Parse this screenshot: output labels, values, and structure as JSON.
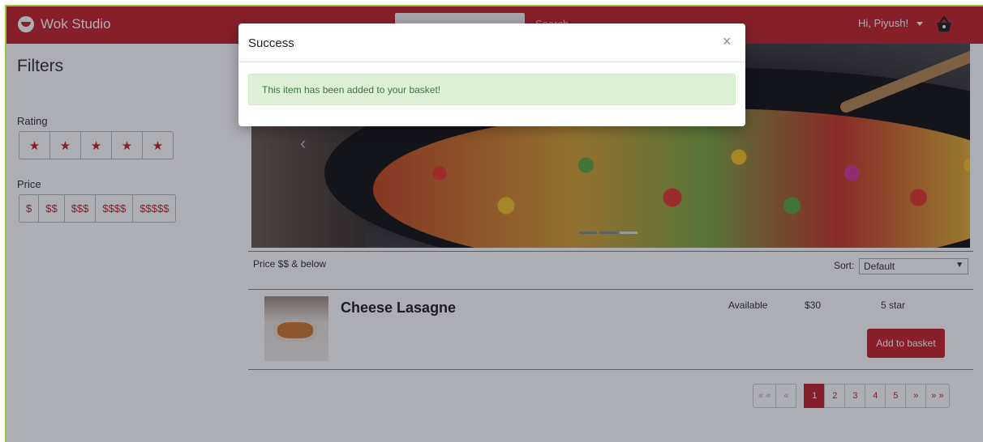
{
  "navbar": {
    "brand": "Wok Studio",
    "search_button": "Search",
    "user_greeting": "Hi, Piyush!",
    "accent_color": "#c4262b"
  },
  "sidebar": {
    "title": "Filters",
    "rating_label": "Rating",
    "rating_options": [
      "★",
      "★",
      "★",
      "★",
      "★"
    ],
    "price_label": "Price",
    "price_options": [
      "$",
      "$$",
      "$$$",
      "$$$$",
      "$$$$$"
    ]
  },
  "carousel": {
    "prev_glyph": "‹",
    "slide_count": 3,
    "active_slide": 3
  },
  "results": {
    "filter_note": "Price $$ & below",
    "sort_label": "Sort:",
    "sort_value": "Default"
  },
  "item": {
    "name": "Cheese Lasagne",
    "availability": "Available",
    "price": "$30",
    "rating": "5 star",
    "add_button": "Add to basket"
  },
  "pagination": {
    "first": "« «",
    "prev": "«",
    "pages": [
      "1",
      "2",
      "3",
      "4",
      "5"
    ],
    "active_page": "1",
    "next": "»",
    "last": "» »"
  },
  "modal": {
    "title": "Success",
    "close_glyph": "×",
    "message": "This item has been added to your basket!",
    "alert_color": "#dff0d8"
  }
}
